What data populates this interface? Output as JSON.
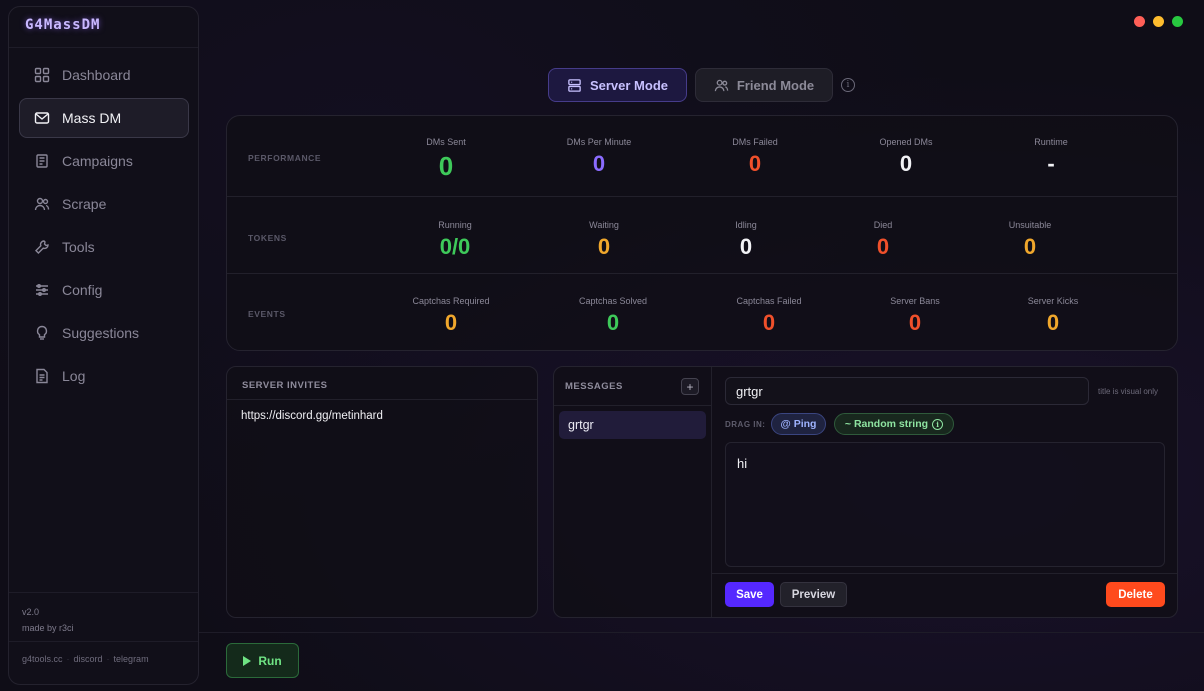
{
  "app": {
    "title": "G4MassDM"
  },
  "window_controls": {
    "colors": [
      "#ff5f57",
      "#febc2e",
      "#28c840"
    ]
  },
  "sidebar": {
    "items": [
      {
        "label": "Dashboard",
        "icon": "grid-icon"
      },
      {
        "label": "Mass DM",
        "icon": "mail-icon",
        "active": true
      },
      {
        "label": "Campaigns",
        "icon": "campaign-icon"
      },
      {
        "label": "Scrape",
        "icon": "users-icon"
      },
      {
        "label": "Tools",
        "icon": "wrench-icon"
      },
      {
        "label": "Config",
        "icon": "sliders-icon"
      },
      {
        "label": "Suggestions",
        "icon": "bulb-icon"
      },
      {
        "label": "Log",
        "icon": "document-icon"
      }
    ],
    "version": "v2.0",
    "credit": "made by r3ci",
    "links": [
      "g4tools.cc",
      "discord",
      "telegram"
    ]
  },
  "modes": {
    "server": "Server Mode",
    "friend": "Friend Mode",
    "active": "server"
  },
  "stats": {
    "performance": {
      "label": "PERFORMANCE",
      "items": [
        {
          "label": "DMs Sent",
          "value": "0",
          "color": "#3ec95a"
        },
        {
          "label": "DMs Per Minute",
          "value": "0",
          "color": "#8b6cff"
        },
        {
          "label": "DMs Failed",
          "value": "0",
          "color": "#f0502b"
        },
        {
          "label": "Opened DMs",
          "value": "0",
          "color": "#f2f2f6"
        },
        {
          "label": "Runtime",
          "value": "-",
          "color": "#f2f2f6"
        }
      ]
    },
    "tokens": {
      "label": "TOKENS",
      "items": [
        {
          "label": "Running",
          "value": "0/0",
          "color": "#3ec95a"
        },
        {
          "label": "Waiting",
          "value": "0",
          "color": "#f0a72c"
        },
        {
          "label": "Idling",
          "value": "0",
          "color": "#f2f2f6"
        },
        {
          "label": "Died",
          "value": "0",
          "color": "#f0502b"
        },
        {
          "label": "Unsuitable",
          "value": "0",
          "color": "#f0a72c"
        }
      ]
    },
    "events": {
      "label": "EVENTS",
      "items": [
        {
          "label": "Captchas Required",
          "value": "0",
          "color": "#f0a72c"
        },
        {
          "label": "Captchas Solved",
          "value": "0",
          "color": "#3ec95a"
        },
        {
          "label": "Captchas Failed",
          "value": "0",
          "color": "#f0502b"
        },
        {
          "label": "Server Bans",
          "value": "0",
          "color": "#f0502b"
        },
        {
          "label": "Server Kicks",
          "value": "0",
          "color": "#f0a72c"
        }
      ]
    }
  },
  "invites": {
    "header": "SERVER INVITES",
    "items": [
      "https://discord.gg/metinhard"
    ]
  },
  "messages": {
    "header": "MESSAGES",
    "add_label": "+",
    "items": [
      "grtgr"
    ],
    "editor": {
      "title_value": "grtgr",
      "title_hint": "title is visual only",
      "drag_label": "DRAG IN:",
      "chip_ping": "@ Ping",
      "chip_random": "~ Random string",
      "body": "hi",
      "save": "Save",
      "preview": "Preview",
      "delete": "Delete"
    }
  },
  "run": {
    "label": "Run"
  }
}
